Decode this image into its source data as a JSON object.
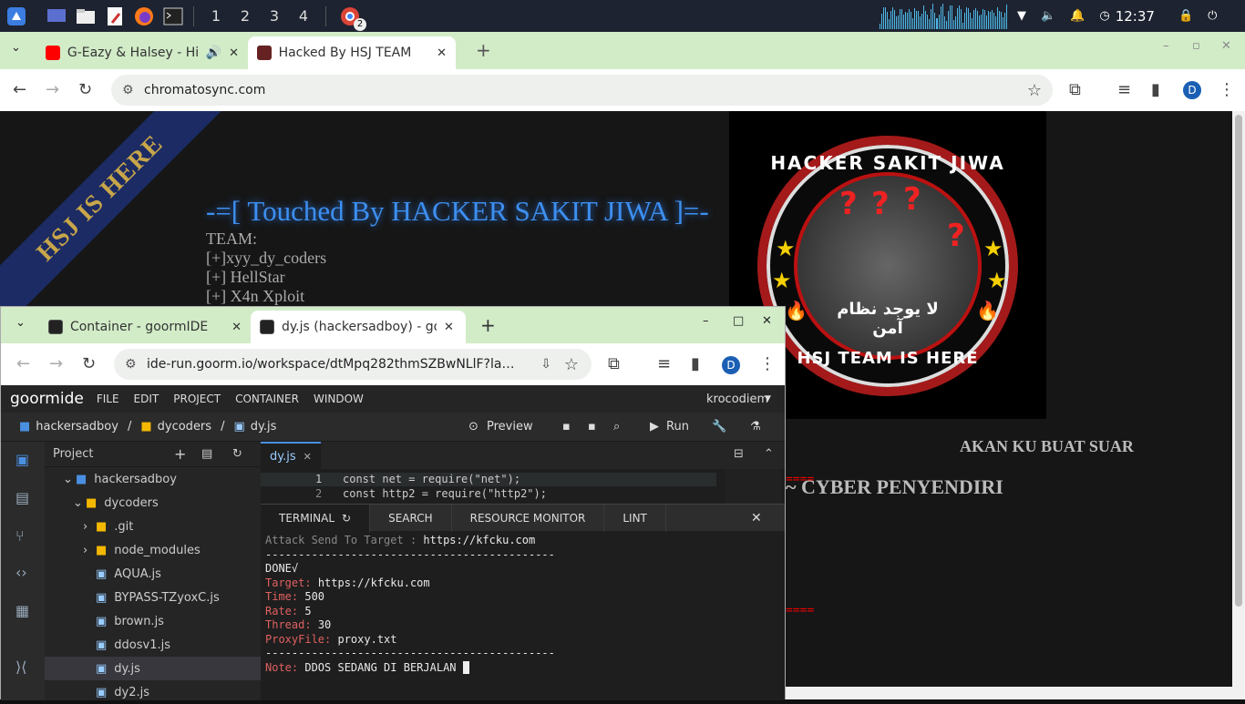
{
  "taskbar": {
    "workspaces": [
      "1",
      "2",
      "3",
      "4"
    ],
    "chrome_badge": "2",
    "clock": "12:37",
    "icons": [
      "app-menu-icon",
      "desktop-icon",
      "files-icon",
      "text-editor-icon",
      "firefox-icon",
      "terminal-icon",
      "chrome-icon",
      "wifi-icon",
      "volume-icon",
      "bell-icon",
      "clock-icon",
      "lock-icon",
      "power-icon"
    ]
  },
  "browser1": {
    "tabs": [
      {
        "title": "G-Eazy & Halsey - Him",
        "favicon": "youtube-icon",
        "audio": true
      },
      {
        "title": "Hacked By HSJ TEAM",
        "favicon": "hsj-icon",
        "active": true
      }
    ],
    "url": "chromatosync.com",
    "profile": "D"
  },
  "page": {
    "ribbon": "HSJ IS HERE",
    "heading": "-=[ Touched By HACKER SAKIT JIWA ]=-",
    "team_label": "TEAM:",
    "members": [
      "[+]xyy_dy_coders",
      "[+] HellStar",
      "[+] X4n Xploit"
    ],
    "logo_top": "HACKER SAKIT JIWA",
    "logo_bottom": "HSJ TEAM IS HERE",
    "logo_arabic": "لا يوجد نظام آمن",
    "sep1": "====",
    "sep2": "====",
    "line_akan": "AKAN KU BUAT SUAR",
    "line_cyber": "~ CYBER PENYENDIRI"
  },
  "browser2": {
    "tabs": [
      {
        "title": "Container - goormIDE"
      },
      {
        "title": "dy.js (hackersadboy) - go",
        "active": true
      }
    ],
    "url": "ide-run.goorm.io/workspace/dtMpq282thmSZBwNLlF?language...",
    "profile": "D"
  },
  "ide": {
    "logo": "goormide",
    "menu": [
      "FILE",
      "EDIT",
      "PROJECT",
      "CONTAINER",
      "WINDOW"
    ],
    "user": "krocodiem",
    "breadcrumb": [
      "hackersadboy",
      "dycoders",
      "dy.js"
    ],
    "preview": "Preview",
    "run": "Run",
    "project_title": "Project",
    "tree": [
      {
        "name": "hackersadboy",
        "type": "project",
        "level": 0
      },
      {
        "name": "dycoders",
        "type": "folder",
        "level": 1
      },
      {
        "name": ".git",
        "type": "folder-closed",
        "level": 2
      },
      {
        "name": "node_modules",
        "type": "folder-closed",
        "level": 2
      },
      {
        "name": "AQUA.js",
        "type": "file",
        "level": 2
      },
      {
        "name": "BYPASS-TZyoxC.js",
        "type": "file",
        "level": 2
      },
      {
        "name": "brown.js",
        "type": "file",
        "level": 2
      },
      {
        "name": "ddosv1.js",
        "type": "file",
        "level": 2
      },
      {
        "name": "dy.js",
        "type": "file",
        "level": 2,
        "selected": true
      },
      {
        "name": "dy2.js",
        "type": "file",
        "level": 2
      }
    ],
    "editor_tab": "dy.js",
    "code": [
      {
        "num": "1",
        "text": "const net = require(\"net\");"
      },
      {
        "num": "2",
        "text": " const http2 = require(\"http2\");"
      }
    ],
    "term_tabs": [
      "TERMINAL",
      "SEARCH",
      "RESOURCE MONITOR",
      "LINT"
    ],
    "terminal": {
      "attack_label": "Attack Send To Target :",
      "attack_value": "https://kfcku.com",
      "divider": "--------------------------------------------",
      "done": "DONE√",
      "rows": [
        {
          "label": "Target:",
          "value": "https://kfcku.com"
        },
        {
          "label": "Time:",
          "value": "500"
        },
        {
          "label": "Rate:",
          "value": "5"
        },
        {
          "label": "Thread:",
          "value": "30"
        },
        {
          "label": "ProxyFile:",
          "value": "proxy.txt"
        }
      ],
      "note_label": "Note:",
      "note_value": "DDOS SEDANG DI BERJALAN"
    }
  }
}
